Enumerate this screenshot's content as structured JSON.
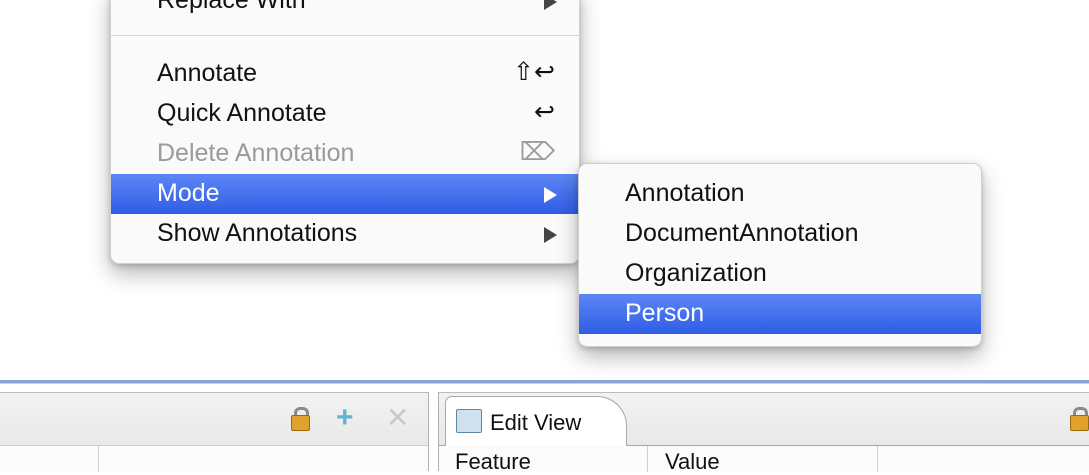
{
  "context_menu": {
    "items": [
      {
        "label": "Replace With",
        "shortcut": "",
        "submenu": true,
        "enabled": true
      },
      {
        "label": "Annotate",
        "shortcut": "⇧↩",
        "submenu": false,
        "enabled": true
      },
      {
        "label": "Quick Annotate",
        "shortcut": "↩",
        "submenu": false,
        "enabled": true
      },
      {
        "label": "Delete Annotation",
        "shortcut": "⌦",
        "submenu": false,
        "enabled": false
      },
      {
        "label": "Mode",
        "shortcut": "",
        "submenu": true,
        "enabled": true,
        "selected": true
      },
      {
        "label": "Show Annotations",
        "shortcut": "",
        "submenu": true,
        "enabled": true
      }
    ]
  },
  "mode_submenu": {
    "items": [
      {
        "label": "Annotation"
      },
      {
        "label": "DocumentAnnotation"
      },
      {
        "label": "Organization"
      },
      {
        "label": "Person",
        "selected": true
      }
    ]
  },
  "bottom_panel": {
    "left_toolbar": {
      "icons": [
        "lock-icon",
        "add-icon",
        "remove-icon"
      ]
    },
    "right_tab": {
      "label": "Edit View",
      "icon": "edit-view-icon"
    },
    "columns": [
      "Feature",
      "Value"
    ]
  },
  "colors": {
    "selection": "#3366e8",
    "menu_bg": "#fafafa",
    "disabled_text": "#9a9a9a"
  }
}
